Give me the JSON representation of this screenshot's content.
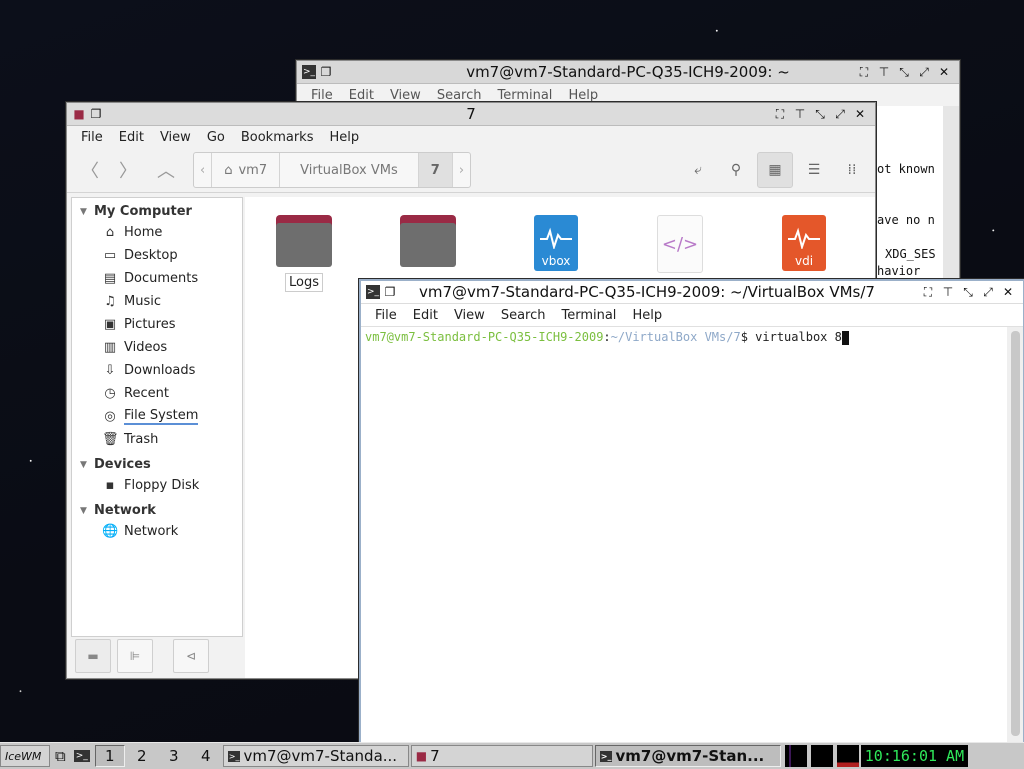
{
  "back_terminal": {
    "title": "vm7@vm7-Standard-PC-Q35-ICH9-2009: ~",
    "menu": [
      "File",
      "Edit",
      "View",
      "Search",
      "Terminal",
      "Help"
    ],
    "visible_lines": [
      "ot known",
      "ave no n",
      "XDG_SES",
      "havior"
    ]
  },
  "file_manager": {
    "title": "7",
    "menu": [
      "File",
      "Edit",
      "View",
      "Go",
      "Bookmarks",
      "Help"
    ],
    "breadcrumb": [
      "vm7",
      "VirtualBox VMs",
      "7"
    ],
    "sidebar": {
      "my_computer": {
        "heading": "My Computer",
        "items": [
          {
            "label": "Home",
            "icon": "home-icon"
          },
          {
            "label": "Desktop",
            "icon": "desktop-icon"
          },
          {
            "label": "Documents",
            "icon": "documents-icon"
          },
          {
            "label": "Music",
            "icon": "music-icon"
          },
          {
            "label": "Pictures",
            "icon": "pictures-icon"
          },
          {
            "label": "Videos",
            "icon": "videos-icon"
          },
          {
            "label": "Downloads",
            "icon": "downloads-icon"
          },
          {
            "label": "Recent",
            "icon": "recent-icon"
          },
          {
            "label": "File System",
            "icon": "filesystem-icon"
          },
          {
            "label": "Trash",
            "icon": "trash-icon"
          }
        ]
      },
      "devices": {
        "heading": "Devices",
        "items": [
          {
            "label": "Floppy Disk",
            "icon": "floppy-icon"
          }
        ]
      },
      "network": {
        "heading": "Network",
        "items": [
          {
            "label": "Network",
            "icon": "network-icon"
          }
        ]
      }
    },
    "files": [
      {
        "label": "Logs",
        "type": "folder"
      },
      {
        "label": "",
        "type": "folder"
      },
      {
        "label": "vbox",
        "type": "vbox"
      },
      {
        "label": "</>",
        "type": "xml"
      },
      {
        "label": "vdi",
        "type": "vdi"
      }
    ]
  },
  "front_terminal": {
    "title": "vm7@vm7-Standard-PC-Q35-ICH9-2009: ~/VirtualBox VMs/7",
    "menu": [
      "File",
      "Edit",
      "View",
      "Search",
      "Terminal",
      "Help"
    ],
    "prompt_user": "vm7@vm7-Standard-PC-Q35-ICH9-2009",
    "prompt_sep": ":",
    "prompt_path": "~/VirtualBox VMs/7",
    "prompt_end": "$ ",
    "command": "virtualbox 8"
  },
  "taskbar": {
    "start": "IceWM",
    "workspaces": [
      "1",
      "2",
      "3",
      "4"
    ],
    "tasks": [
      {
        "label": "vm7@vm7-Standa...",
        "active": false
      },
      {
        "label": "7",
        "active": false
      },
      {
        "label": "vm7@vm7-Stan...",
        "active": true
      }
    ],
    "clock": "10:16:01 AM"
  },
  "colors": {
    "prompt_user": "#7bbf3f",
    "prompt_path": "#8ea8c8",
    "clock": "#2fe85a",
    "folder_tab": "#9a2a45",
    "vbox": "#2a8ad4",
    "vdi": "#e4572a"
  }
}
